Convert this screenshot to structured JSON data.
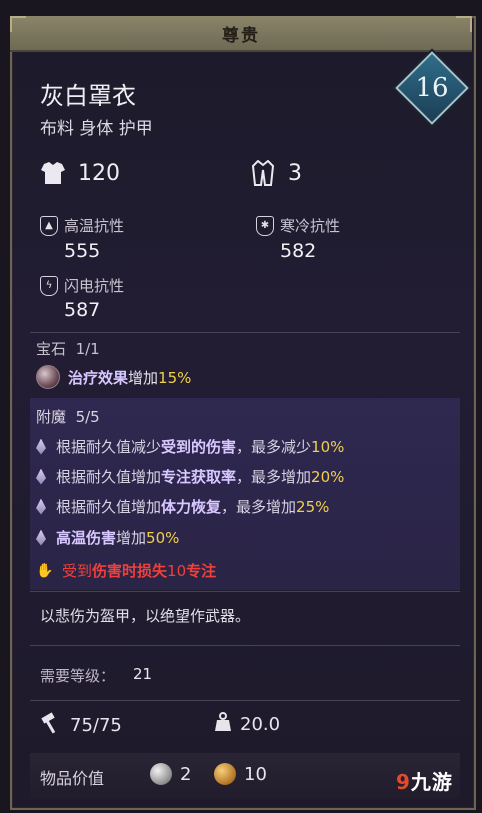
{
  "rarity": "尊贵",
  "item": {
    "name": "灰白罩衣",
    "type": "布料 身体 护甲",
    "level": "16"
  },
  "stats": {
    "armor": "120",
    "weight_class": "3"
  },
  "resistances": [
    {
      "label": "高温抗性",
      "value": "555",
      "icon": "fire-resist-icon"
    },
    {
      "label": "寒冷抗性",
      "value": "582",
      "icon": "cold-resist-icon"
    },
    {
      "label": "闪电抗性",
      "value": "587",
      "icon": "lightning-resist-icon"
    }
  ],
  "gem": {
    "header": "宝石",
    "count": "1/1",
    "effect_name": "治疗效果",
    "effect_text": "增加",
    "effect_value": "15%"
  },
  "enchant": {
    "header": "附魔",
    "count": "5/5",
    "lines": [
      {
        "pre": "根据耐久值减少",
        "hl": "受到的伤害",
        "mid": "，最多减少",
        "num": "10%"
      },
      {
        "pre": "根据耐久值增加",
        "hl": "专注获取率",
        "mid": "，最多增加",
        "num": "20%"
      },
      {
        "pre": "根据耐久值增加",
        "hl": "体力恢复",
        "mid": "，最多增加",
        "num": "25%"
      },
      {
        "pre": "",
        "hl": "高温伤害",
        "mid": "增加",
        "num": "50%"
      }
    ],
    "curse": {
      "pre": "受到",
      "b1": "伤害时损失",
      "num": "10",
      "b2": "专注"
    }
  },
  "flavor": "以悲伤为盔甲，以绝望作武器。",
  "requirement": {
    "label": "需要等级：",
    "value": "21"
  },
  "durability": "75/75",
  "weight": "20.0",
  "value": {
    "label": "物品价值",
    "silver": "2",
    "gold": "10"
  },
  "watermark": "九游",
  "colors": {
    "highlight": "#d8c8ff",
    "number": "#f0d04a",
    "curse": "#f0403a",
    "rarity_bar": "#8a8468"
  }
}
